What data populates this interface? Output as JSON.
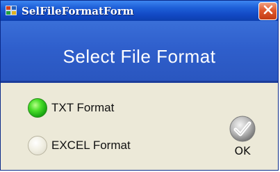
{
  "window": {
    "title": "SelFileFormatForm",
    "icon": "app-icon",
    "close_icon": "close-icon"
  },
  "header": {
    "title": "Select File Format"
  },
  "options": [
    {
      "label": "TXT Format",
      "selected": true
    },
    {
      "label": "EXCEL Format",
      "selected": false
    }
  ],
  "ok_button": {
    "label": "OK",
    "icon": "checkmark-icon"
  },
  "colors": {
    "title_bar": "#1e5fd8",
    "header_band": "#2f5fcc",
    "body_bg": "#ece9d8",
    "radio_selected": "#1aa812",
    "close_button": "#e0582e"
  }
}
